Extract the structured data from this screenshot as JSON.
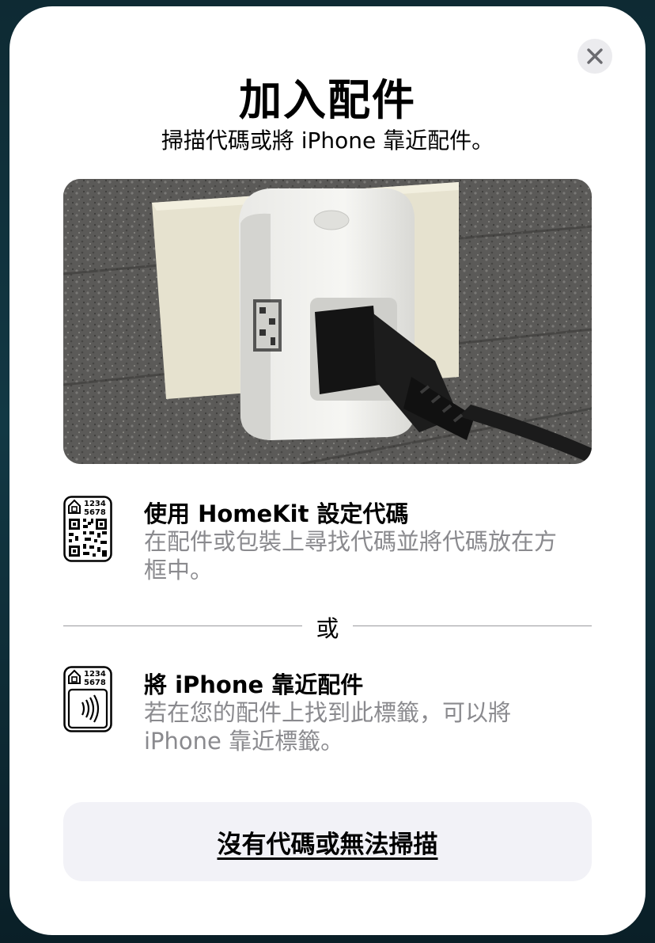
{
  "sheet": {
    "title": "加入配件",
    "subtitle": "掃描代碼或將 iPhone 靠近配件。",
    "close_icon": "close-icon"
  },
  "photo": {
    "description_icon": "smart-plug-photo"
  },
  "options": [
    {
      "icon": "homekit-qr-code-icon",
      "code_line1": "1234",
      "code_line2": "5678",
      "title": "使用 HomeKit 設定代碼",
      "desc_line1": "在配件或包裝上尋找代碼並將代碼放在方",
      "desc_line2": "框中。"
    },
    {
      "icon": "homekit-nfc-tag-icon",
      "code_line1": "1234",
      "code_line2": "5678",
      "title": "將 iPhone 靠近配件",
      "desc_line1": "若在您的配件上找到此標籤，可以將",
      "desc_line2": "iPhone 靠近標籤。"
    }
  ],
  "divider": {
    "label": "或"
  },
  "footer": {
    "no_code_label": "沒有代碼或無法掃描"
  }
}
